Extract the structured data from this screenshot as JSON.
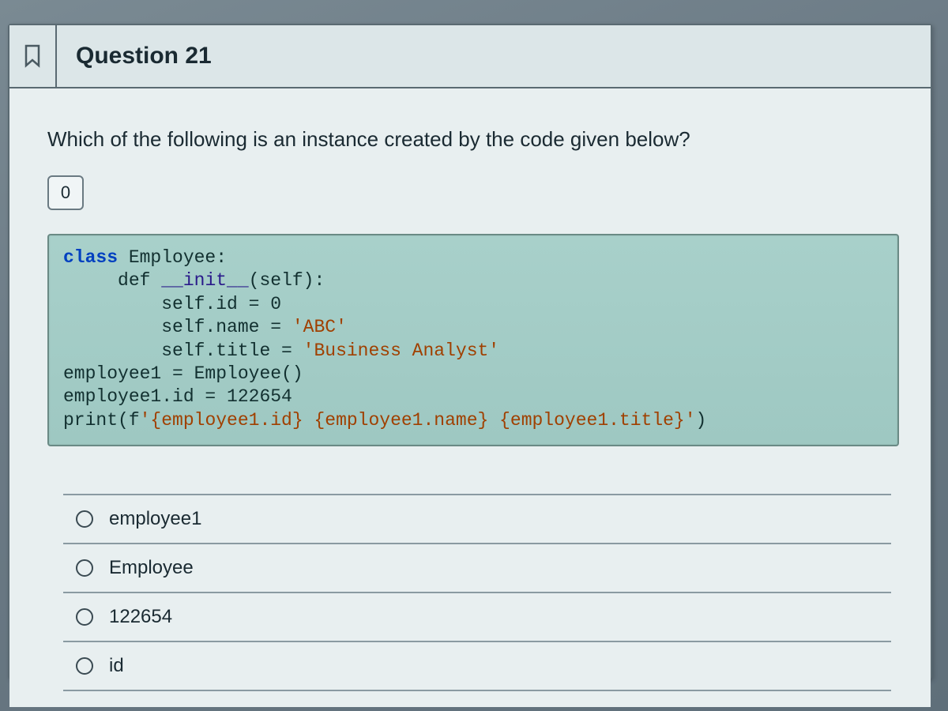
{
  "header": {
    "title": "Question 21"
  },
  "prompt": "Which of the following is an instance created by the code given below?",
  "points_value": "0",
  "code": {
    "l1_a": "class",
    "l1_b": " Employee:",
    "l2_a": "     def ",
    "l2_b": "__init__",
    "l2_c": "(self):",
    "l3": "         self.id = 0",
    "l4_a": "         self.name = ",
    "l4_b": "'ABC'",
    "l5_a": "         self.title = ",
    "l5_b": "'Business Analyst'",
    "l6": "employee1 = Employee()",
    "l7": "employee1.id = 122654",
    "l8_a": "print(f",
    "l8_b": "'{employee1.id} {employee1.name} {employee1.title}'",
    "l8_c": ")"
  },
  "answers": {
    "a": "employee1",
    "b": "Employee",
    "c": "122654",
    "d": "id"
  }
}
